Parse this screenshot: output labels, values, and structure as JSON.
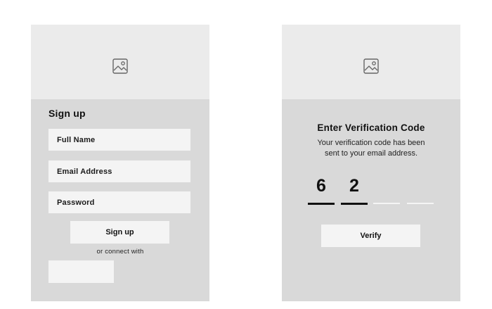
{
  "signup": {
    "title": "Sign up",
    "fields": [
      {
        "placeholder": "Full Name"
      },
      {
        "placeholder": "Email Address"
      },
      {
        "placeholder": "Password"
      }
    ],
    "submit_label": "Sign up",
    "connect_label": "or connect with",
    "icon": "image-placeholder-icon"
  },
  "verify": {
    "title": "Enter Verification Code",
    "description_lines": [
      "Your verification code has been",
      "sent to your email address."
    ],
    "digits": [
      "6",
      "2",
      "",
      ""
    ],
    "submit_label": "Verify",
    "icon": "image-placeholder-icon"
  },
  "colors": {
    "card": "#d9d9d9",
    "hero": "#ebebeb",
    "field": "#f4f4f4",
    "text": "#111111"
  }
}
